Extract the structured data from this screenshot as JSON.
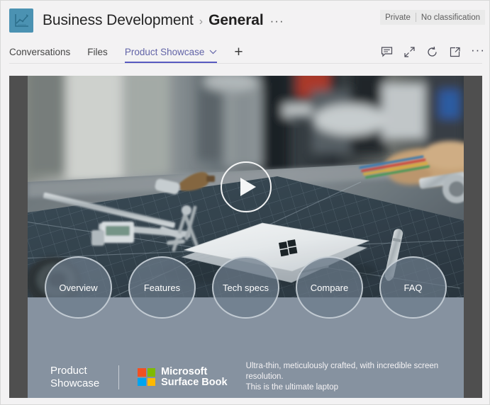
{
  "header": {
    "avatar_icon": "line-chart-icon",
    "team_name": "Business Development",
    "separator": "›",
    "channel_name": "General",
    "more_options": "···",
    "classification": {
      "privacy": "Private",
      "label": "No classification"
    }
  },
  "tabs": {
    "items": [
      {
        "label": "Conversations",
        "active": false
      },
      {
        "label": "Files",
        "active": false
      },
      {
        "label": "Product Showcase",
        "active": true
      }
    ],
    "add_label": "+",
    "actions": [
      {
        "name": "chat-icon"
      },
      {
        "name": "expand-icon"
      },
      {
        "name": "refresh-icon"
      },
      {
        "name": "open-in-new-window-icon"
      },
      {
        "name": "more-options-icon",
        "label": "···"
      }
    ]
  },
  "content": {
    "video": {
      "alt": "Surface Book on a workbench with precision tools",
      "play_label": "Play"
    },
    "nav_circles": [
      {
        "label": "Overview"
      },
      {
        "label": "Features"
      },
      {
        "label": "Tech specs"
      },
      {
        "label": "Compare"
      },
      {
        "label": "FAQ"
      }
    ],
    "brand": {
      "product_line1": "Product",
      "product_line2": "Showcase",
      "ms_line1": "Microsoft",
      "ms_line2": "Surface Book",
      "tagline_line1": "Ultra-thin, meticulously crafted, with incredible screen resolution.",
      "tagline_line2": "This is the ultimate laptop"
    }
  },
  "colors": {
    "teams_purple": "#6264a7",
    "avatar_teal": "#4b92b2",
    "panel_gray": "#8692a0",
    "frame_gray": "#4f4f4f",
    "ms_red": "#f25022",
    "ms_green": "#7fba00",
    "ms_blue": "#00a4ef",
    "ms_yellow": "#ffb900"
  }
}
